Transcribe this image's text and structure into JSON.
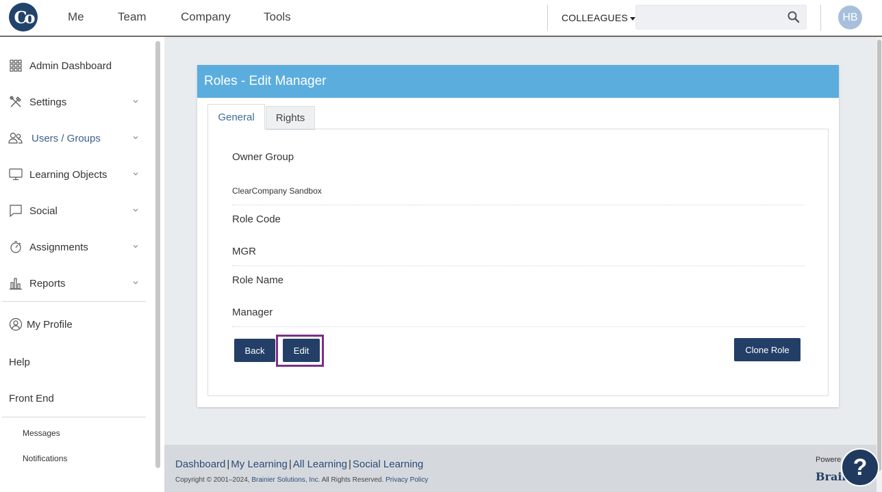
{
  "brand": {
    "logo_text": "Co",
    "navy": "#22436b",
    "header_blue": "#5badde",
    "accent_purple": "#7b2e86"
  },
  "topnav": {
    "items": [
      "Me",
      "Team",
      "Company",
      "Tools"
    ],
    "colleagues_label": "COLLEAGUES",
    "search": {
      "value": "",
      "placeholder": ""
    },
    "avatar_initials": "HB"
  },
  "sidebar": {
    "items": [
      {
        "label": "Admin Dashboard",
        "icon": "grid-icon"
      },
      {
        "label": "Settings",
        "icon": "tools-icon"
      },
      {
        "label": "Users / Groups",
        "icon": "users-icon"
      },
      {
        "label": "Learning Objects",
        "icon": "monitor-icon"
      },
      {
        "label": "Social",
        "icon": "chat-icon"
      },
      {
        "label": "Assignments",
        "icon": "stopwatch-icon"
      },
      {
        "label": "Reports",
        "icon": "bar-chart-icon"
      }
    ],
    "my_profile": "My Profile",
    "help": "Help",
    "front_end": "Front End",
    "messages": "Messages",
    "notifications": "Notifications"
  },
  "panel": {
    "title": "Roles - Edit Manager",
    "tabs": [
      "General",
      "Rights"
    ],
    "fields": [
      {
        "label": "Owner Group",
        "value": "ClearCompany Sandbox"
      },
      {
        "label": "Role Code",
        "value": "MGR"
      },
      {
        "label": "Role Name",
        "value": "Manager"
      }
    ],
    "buttons": {
      "back": "Back",
      "edit": "Edit",
      "clone": "Clone Role"
    }
  },
  "footer": {
    "links": [
      "Dashboard",
      "My Learning",
      "All Learning",
      "Social Learning"
    ],
    "copyright_prefix": "Copyright © 2001–2024,",
    "company_link": "Brainier Solutions, Inc.",
    "rights": "All Rights Reserved.",
    "privacy": "Privacy Policy",
    "powered": "Powere",
    "brainier": "Brain"
  },
  "help_button": "?"
}
